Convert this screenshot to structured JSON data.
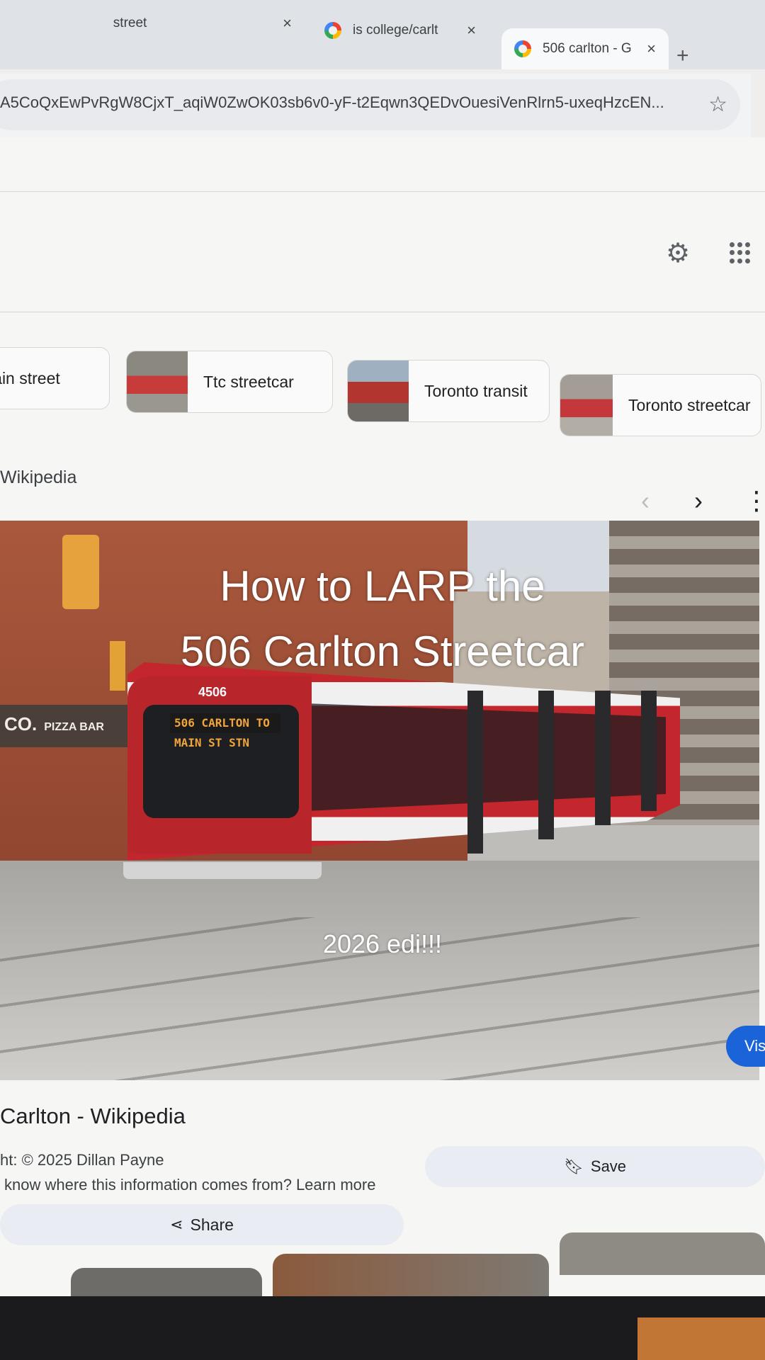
{
  "browser": {
    "tabs": [
      {
        "title": "street",
        "active": false
      },
      {
        "title": "is college/carlt",
        "active": false
      },
      {
        "title": "506 carlton - G",
        "active": true
      }
    ],
    "new_tab_glyph": "+",
    "close_glyph": "×",
    "url": "A5CoQxEwPvRgW8CjxT_aqiW0ZwOK03sb6v0-yF-t2Eqwn3QEDvOuesiVenRlrn5-uxeqHzcEN...",
    "bookmark_icon": "star-icon"
  },
  "header": {
    "settings_icon": "gear-icon",
    "apps_icon": "apps-grid-icon"
  },
  "chips": [
    {
      "label": "Main street"
    },
    {
      "label": "Ttc streetcar"
    },
    {
      "label": "Toronto transit"
    },
    {
      "label": "Toronto streetcar"
    }
  ],
  "result": {
    "source": "Wikipedia",
    "prev_glyph": "‹",
    "next_glyph": "›",
    "more_glyph": "⋮",
    "photo": {
      "shop_name": "CO.",
      "shop_sub": "PIZZA BAR",
      "tram_number": "4506",
      "destination": "506 CARLTON TO MAIN ST STN"
    },
    "overlay_title_line1": "How to LARP the",
    "overlay_title_line2": "506 Carlton Streetcar",
    "overlay_subtitle": "2026 edi!!!",
    "visit_label": "Visi",
    "title": "Carlton - Wikipedia",
    "copyright": "ht: © 2025 Dillan Payne",
    "info_text": "know where this information comes from?",
    "learn_more": "Learn more",
    "save_label": "Save",
    "share_label": "Share"
  },
  "colors": {
    "accent_blue": "#1a63d8",
    "tram_red": "#c3272d"
  }
}
